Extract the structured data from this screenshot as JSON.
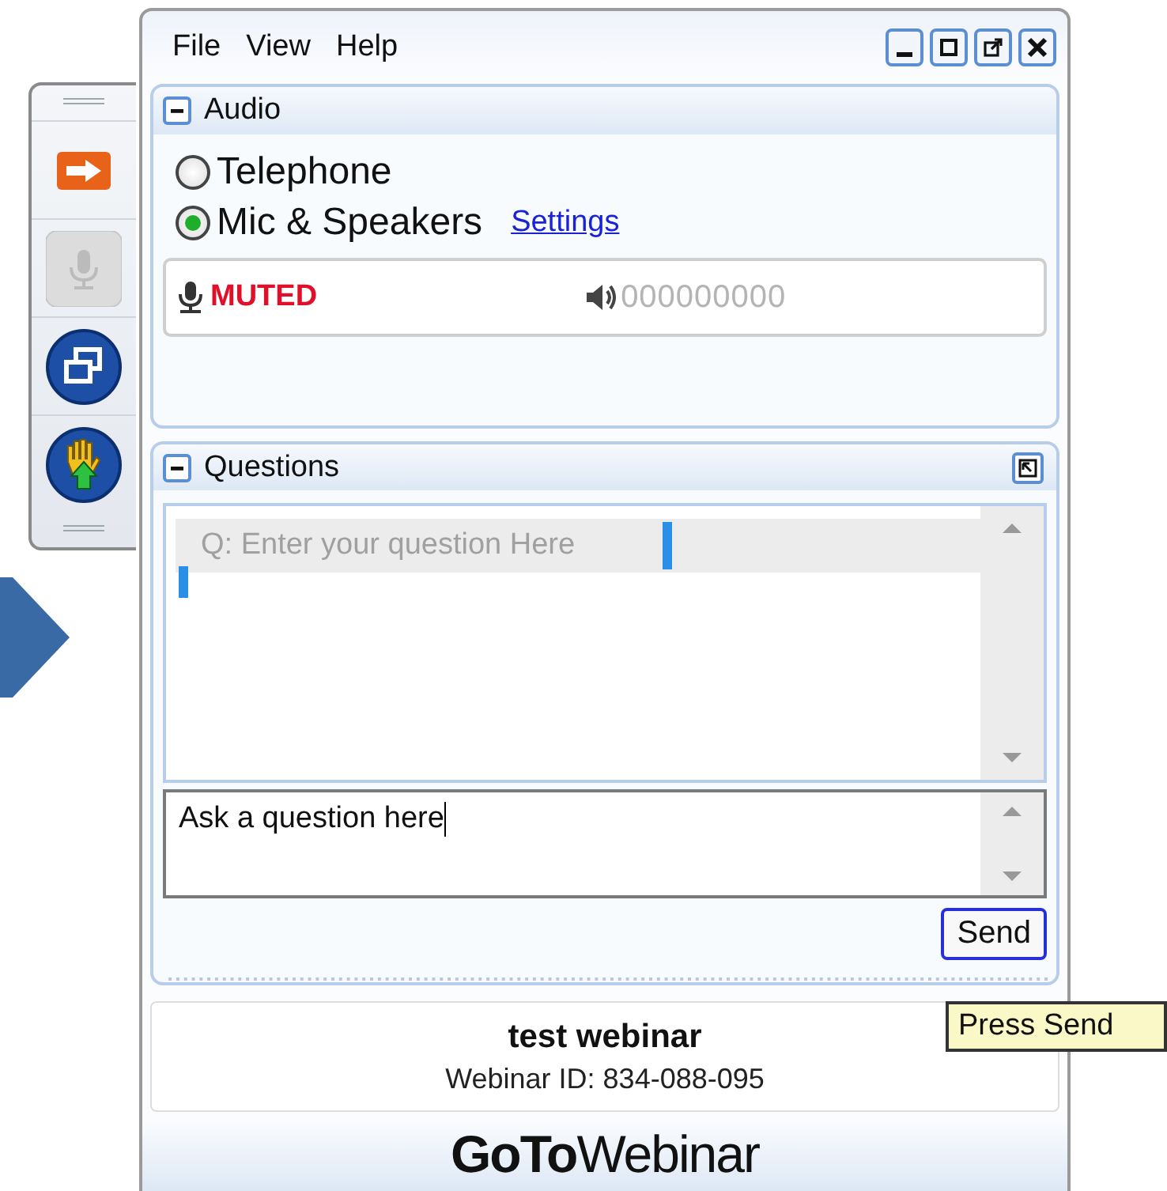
{
  "menu": [
    "File",
    "View",
    "Help"
  ],
  "toolbar": {
    "buttons": [
      {
        "kind": "arrow",
        "disabled": false
      },
      {
        "kind": "mic",
        "disabled": true
      },
      {
        "kind": "restore",
        "disabled": false
      },
      {
        "kind": "hand",
        "disabled": false
      }
    ]
  },
  "audio": {
    "title": "Audio",
    "options": [
      {
        "label": "Telephone",
        "selected": false
      },
      {
        "label": "Mic & Speakers",
        "selected": true
      }
    ],
    "settings_link": "Settings",
    "mic_status": "MUTED",
    "speaker_meter": "000000000"
  },
  "questions": {
    "title": "Questions",
    "items": [
      {
        "text": "Q: Enter your question Here",
        "selected": true
      }
    ],
    "input": {
      "value": "Ask a question here"
    },
    "send": "Send"
  },
  "info": {
    "title": "test webinar",
    "webinar_id": "Webinar ID: 834-088-095"
  },
  "logo": "**GoTo**Webinar",
  "tooltip": "Press Send"
}
